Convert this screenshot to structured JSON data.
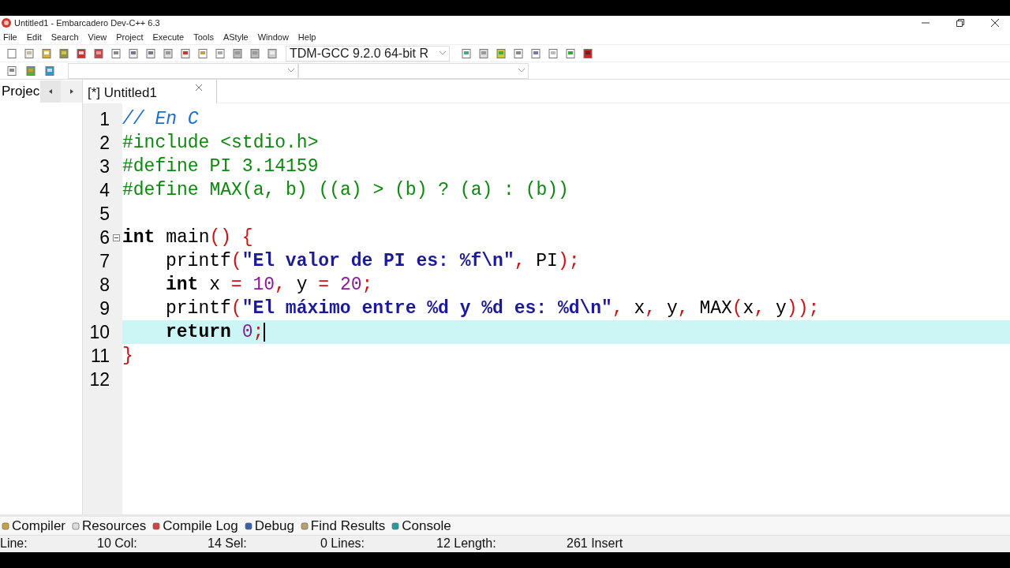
{
  "window": {
    "title": "Untitled1 - Embarcadero Dev-C++ 6.3"
  },
  "menu": [
    "File",
    "Edit",
    "Search",
    "View",
    "Project",
    "Execute",
    "Tools",
    "AStyle",
    "Window",
    "Help"
  ],
  "toolbar": {
    "compiler": "TDM-GCC 9.2.0 64-bit R"
  },
  "left_panel": {
    "tab": "Projec"
  },
  "editor_tabs": [
    {
      "label": "[*] Untitled1",
      "selected": true
    }
  ],
  "editor": {
    "lines": [
      {
        "number": "1",
        "current": false,
        "fold": false,
        "tokens": [
          {
            "kind": "comment",
            "text": "// En C"
          }
        ]
      },
      {
        "number": "2",
        "current": false,
        "fold": false,
        "tokens": [
          {
            "kind": "preproc",
            "text": "#include <stdio.h>"
          }
        ]
      },
      {
        "number": "3",
        "current": false,
        "fold": false,
        "tokens": [
          {
            "kind": "preproc",
            "text": "#define PI 3.14159"
          }
        ]
      },
      {
        "number": "4",
        "current": false,
        "fold": false,
        "tokens": [
          {
            "kind": "preproc",
            "text": "#define MAX(a, b) ((a) > (b) ? (a) : (b))"
          }
        ]
      },
      {
        "number": "5",
        "current": false,
        "fold": false
      },
      {
        "number": "6",
        "current": false,
        "fold": true,
        "tokens": [
          {
            "kind": "keyword",
            "text": "int"
          },
          {
            "kind": "plain",
            "text": " main"
          },
          {
            "kind": "symbol",
            "text": "() {"
          }
        ]
      },
      {
        "number": "7",
        "current": false,
        "fold": false,
        "indented": true,
        "tokens": [
          {
            "kind": "plain",
            "text": "printf"
          },
          {
            "kind": "symbol",
            "text": "("
          },
          {
            "kind": "string",
            "text": "\"El valor de PI es: %f\\n\""
          },
          {
            "kind": "symbol",
            "text": ", "
          },
          {
            "kind": "plain",
            "text": "PI"
          },
          {
            "kind": "symbol",
            "text": ");"
          }
        ]
      },
      {
        "number": "8",
        "current": false,
        "fold": false,
        "indented": true,
        "tokens": [
          {
            "kind": "keyword",
            "text": "int"
          },
          {
            "kind": "plain",
            "text": " x "
          },
          {
            "kind": "symbol",
            "text": "= "
          },
          {
            "kind": "number",
            "text": "10"
          },
          {
            "kind": "symbol",
            "text": ", "
          },
          {
            "kind": "plain",
            "text": "y "
          },
          {
            "kind": "symbol",
            "text": "= "
          },
          {
            "kind": "number",
            "text": "20"
          },
          {
            "kind": "symbol",
            "text": ";"
          }
        ]
      },
      {
        "number": "9",
        "current": false,
        "fold": false,
        "indented": true,
        "tokens": [
          {
            "kind": "plain",
            "text": "printf"
          },
          {
            "kind": "symbol",
            "text": "("
          },
          {
            "kind": "string",
            "text": "\"El máximo entre %d y %d es: %d\\n\""
          },
          {
            "kind": "symbol",
            "text": ", "
          },
          {
            "kind": "plain",
            "text": "x"
          },
          {
            "kind": "symbol",
            "text": ", "
          },
          {
            "kind": "plain",
            "text": "y"
          },
          {
            "kind": "symbol",
            "text": ", "
          },
          {
            "kind": "plain",
            "text": "MAX"
          },
          {
            "kind": "symbol",
            "text": "("
          },
          {
            "kind": "plain",
            "text": "x"
          },
          {
            "kind": "symbol",
            "text": ", "
          },
          {
            "kind": "plain",
            "text": "y"
          },
          {
            "kind": "symbol",
            "text": "));"
          }
        ]
      },
      {
        "number": "10",
        "current": true,
        "fold": false,
        "indented": true,
        "tokens": [
          {
            "kind": "keyword",
            "text": "return "
          },
          {
            "kind": "number",
            "text": "0"
          },
          {
            "kind": "symbol",
            "text": ";"
          }
        ]
      },
      {
        "number": "11",
        "current": false,
        "fold": false,
        "tokens": [
          {
            "kind": "symbol",
            "text": "}"
          }
        ]
      },
      {
        "number": "12",
        "current": false,
        "fold": false
      }
    ]
  },
  "bottom_tabs": [
    "Compiler",
    "Resources",
    "Compile Log",
    "Debug",
    "Find Results",
    "Console"
  ],
  "status_bar": [
    "Line:",
    "10 Col:",
    "14 Sel:",
    "0 Lines:",
    "12 Length:",
    "261 Insert"
  ]
}
